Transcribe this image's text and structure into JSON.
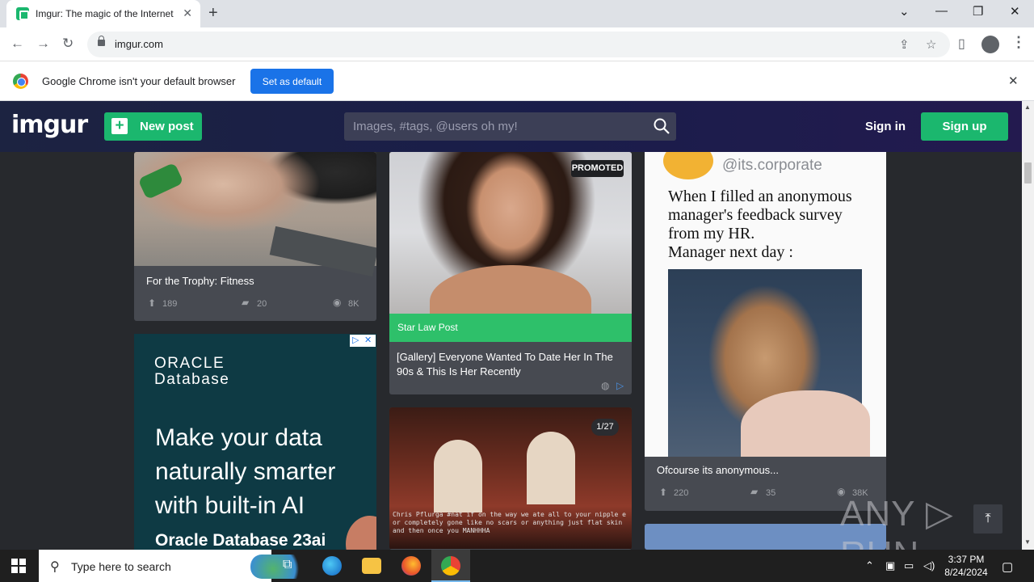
{
  "browser": {
    "tab_title": "Imgur: The magic of the Internet",
    "tab_close": "✕",
    "new_tab": "+",
    "url": "imgur.com",
    "window_controls": {
      "dropdown": "⌄",
      "minimize": "—",
      "restore": "❐",
      "close": "✕"
    }
  },
  "infobar": {
    "message": "Google Chrome isn't your default browser",
    "button": "Set as default",
    "close": "✕"
  },
  "imgur": {
    "logo": "imgur",
    "new_post": "New post",
    "search_placeholder": "Images, #tags, @users oh my!",
    "sign_in": "Sign in",
    "sign_up": "Sign up",
    "brand_green": "#1bb76e"
  },
  "posts": {
    "fitness": {
      "title": "For the Trophy: Fitness",
      "upvotes": "189",
      "comments": "20",
      "views": "8K"
    },
    "promoted": {
      "badge": "PROMOTED",
      "source": "Star Law Post",
      "title": "[Gallery] Everyone Wanted To Date Her In The 90s & This Is Her Recently"
    },
    "valentine": {
      "count": "1/27",
      "caption": "Chris Pflurga #nat if on the way we ate all to your nipple e or completely gone like no scars or anything just flat skin and then once you MANHHHA"
    },
    "corporate": {
      "handle": "@its.corporate",
      "text_lines": [
        "When I filled an anonymous",
        "manager's feedback survey",
        "from my HR.",
        "Manager next day :"
      ],
      "title": "Ofcourse its anonymous...",
      "upvotes": "220",
      "comments": "35",
      "views": "38K"
    }
  },
  "ad": {
    "brand": "ORACLE",
    "product": "Database",
    "headline": "Make your data naturally smarter with built-in AI",
    "subhead": "Oracle Database 23ai"
  },
  "watermark": "ANY ▷ RUN",
  "taskbar": {
    "search_placeholder": "Type here to search",
    "time": "3:37 PM",
    "date": "8/24/2024"
  }
}
